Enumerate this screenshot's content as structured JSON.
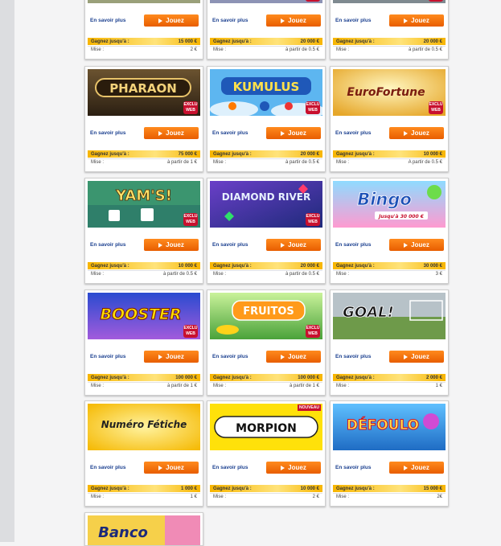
{
  "common": {
    "learn_more": "En savoir plus",
    "play": "Jouez",
    "gain_label": "Gagnez jusqu'à :",
    "mise_label": "Mise :",
    "exclu_line1": "EXCLU",
    "exclu_line2": "WEB",
    "nouveau": "NOUVEAU"
  },
  "games": [
    {
      "title": "",
      "gain": "15 000 €",
      "mise": "2 €"
    },
    {
      "title": "",
      "gain": "20 000 €",
      "mise": "à partir de 0.5 €"
    },
    {
      "title": "",
      "gain": "20 000 €",
      "mise": "à partir de 0.5 €"
    },
    {
      "title": "PHARAON",
      "gain": "75 000 €",
      "mise": "à partir de 1 €"
    },
    {
      "title": "KUMULUS",
      "gain": "20 000 €",
      "mise": "à partir de 0.5 €"
    },
    {
      "title": "EuroFortune",
      "gain": "10 000 €",
      "mise": "A partir de 0.5 €"
    },
    {
      "title": "YAM'S!",
      "gain": "10 000 €",
      "mise": "à partir de 0.5 €"
    },
    {
      "title": "DIAMOND RIVER",
      "gain": "20 000 €",
      "mise": "à partir de 0.5 €"
    },
    {
      "title": "Bingo",
      "subtitle": "Jusqu'à 30 000 €",
      "gain": "30 000 €",
      "mise": "3 €"
    },
    {
      "title": "BOOSTER",
      "gain": "100 000 €",
      "mise": "à partir de 1 €"
    },
    {
      "title": "FRUITOS",
      "gain": "100 000 €",
      "mise": "à partir de 1 €"
    },
    {
      "title": "GOAL!",
      "gain": "2 000 €",
      "mise": "1 €"
    },
    {
      "title": "Numéro Fétiche",
      "gain": "1 000 €",
      "mise": "1 €"
    },
    {
      "title": "MORPION",
      "gain": "10 000 €",
      "mise": "2 €"
    },
    {
      "title": "DÉFOULO",
      "gain": "15 000 €",
      "mise": "2€"
    },
    {
      "title": "Banco"
    }
  ],
  "colors": {
    "play_button": "#f07010",
    "gain_bar": "#f7b500",
    "link": "#1a3f8f",
    "exclu": "#c8102e"
  }
}
